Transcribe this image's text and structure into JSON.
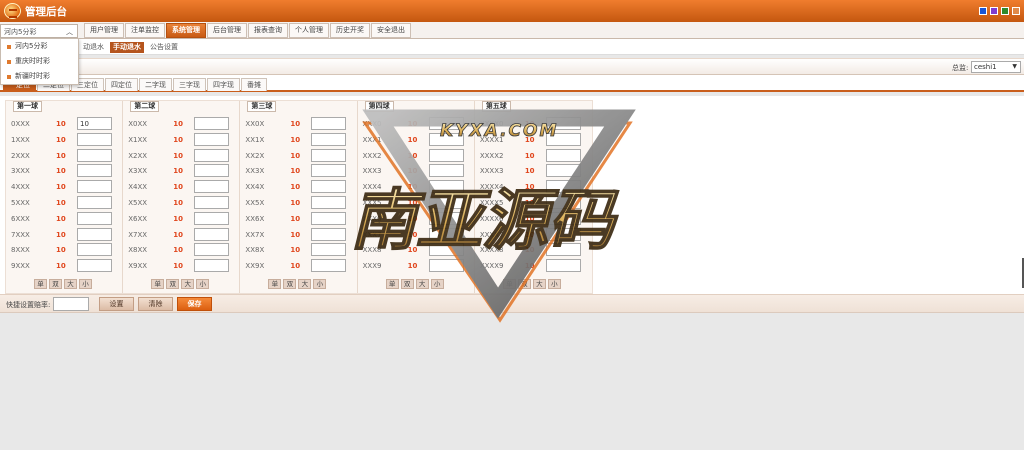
{
  "app": {
    "title": "管理后台",
    "theme_swatches": [
      "#1a56d6",
      "#7d3ccf",
      "#2f8a2c",
      "#e08a4a"
    ]
  },
  "lottery_select": {
    "value": "河内5分彩"
  },
  "lottery_dropdown": {
    "items": [
      "河内5分彩",
      "重庆时时彩",
      "新疆时时彩"
    ]
  },
  "nav": {
    "items": [
      {
        "label": "用户管理",
        "active": false
      },
      {
        "label": "注单监控",
        "active": false
      },
      {
        "label": "系统管理",
        "active": true
      },
      {
        "label": "后台管理",
        "active": false
      },
      {
        "label": "报表查询",
        "active": false
      },
      {
        "label": "个人管理",
        "active": false
      },
      {
        "label": "历史开奖",
        "active": false
      },
      {
        "label": "安全退出",
        "active": false
      }
    ]
  },
  "subnav": {
    "items": [
      {
        "label": "动退水",
        "active": false
      },
      {
        "label": "手动退水",
        "active": true
      },
      {
        "label": "公告设置",
        "active": false
      }
    ]
  },
  "account": {
    "label": "总监:",
    "value": "ceshi1"
  },
  "tabs": [
    {
      "label": "一定位",
      "active": true
    },
    {
      "label": "二定位",
      "active": false
    },
    {
      "label": "三定位",
      "active": false
    },
    {
      "label": "四定位",
      "active": false
    },
    {
      "label": "二字现",
      "active": false
    },
    {
      "label": "三字现",
      "active": false
    },
    {
      "label": "四字现",
      "active": false
    },
    {
      "label": "番摊",
      "active": false
    }
  ],
  "panels": [
    {
      "title": "第一球",
      "rows": [
        {
          "label": "0XXX",
          "odds": "10",
          "value": "10"
        },
        {
          "label": "1XXX",
          "odds": "10",
          "value": ""
        },
        {
          "label": "2XXX",
          "odds": "10",
          "value": ""
        },
        {
          "label": "3XXX",
          "odds": "10",
          "value": ""
        },
        {
          "label": "4XXX",
          "odds": "10",
          "value": ""
        },
        {
          "label": "5XXX",
          "odds": "10",
          "value": ""
        },
        {
          "label": "6XXX",
          "odds": "10",
          "value": ""
        },
        {
          "label": "7XXX",
          "odds": "10",
          "value": ""
        },
        {
          "label": "8XXX",
          "odds": "10",
          "value": ""
        },
        {
          "label": "9XXX",
          "odds": "10",
          "value": ""
        }
      ]
    },
    {
      "title": "第二球",
      "rows": [
        {
          "label": "X0XX",
          "odds": "10",
          "value": ""
        },
        {
          "label": "X1XX",
          "odds": "10",
          "value": ""
        },
        {
          "label": "X2XX",
          "odds": "10",
          "value": ""
        },
        {
          "label": "X3XX",
          "odds": "10",
          "value": ""
        },
        {
          "label": "X4XX",
          "odds": "10",
          "value": ""
        },
        {
          "label": "X5XX",
          "odds": "10",
          "value": ""
        },
        {
          "label": "X6XX",
          "odds": "10",
          "value": ""
        },
        {
          "label": "X7XX",
          "odds": "10",
          "value": ""
        },
        {
          "label": "X8XX",
          "odds": "10",
          "value": ""
        },
        {
          "label": "X9XX",
          "odds": "10",
          "value": ""
        }
      ]
    },
    {
      "title": "第三球",
      "rows": [
        {
          "label": "XX0X",
          "odds": "10",
          "value": ""
        },
        {
          "label": "XX1X",
          "odds": "10",
          "value": ""
        },
        {
          "label": "XX2X",
          "odds": "10",
          "value": ""
        },
        {
          "label": "XX3X",
          "odds": "10",
          "value": ""
        },
        {
          "label": "XX4X",
          "odds": "10",
          "value": ""
        },
        {
          "label": "XX5X",
          "odds": "10",
          "value": ""
        },
        {
          "label": "XX6X",
          "odds": "10",
          "value": ""
        },
        {
          "label": "XX7X",
          "odds": "10",
          "value": ""
        },
        {
          "label": "XX8X",
          "odds": "10",
          "value": ""
        },
        {
          "label": "XX9X",
          "odds": "10",
          "value": ""
        }
      ]
    },
    {
      "title": "第四球",
      "rows": [
        {
          "label": "XXX0",
          "odds": "10",
          "value": ""
        },
        {
          "label": "XXX1",
          "odds": "10",
          "value": ""
        },
        {
          "label": "XXX2",
          "odds": "10",
          "value": ""
        },
        {
          "label": "XXX3",
          "odds": "10",
          "value": ""
        },
        {
          "label": "XXX4",
          "odds": "10",
          "value": ""
        },
        {
          "label": "XXX5",
          "odds": "10",
          "value": ""
        },
        {
          "label": "XXX6",
          "odds": "10",
          "value": ""
        },
        {
          "label": "XXX7",
          "odds": "10",
          "value": ""
        },
        {
          "label": "XXX8",
          "odds": "10",
          "value": ""
        },
        {
          "label": "XXX9",
          "odds": "10",
          "value": ""
        }
      ]
    },
    {
      "title": "第五球",
      "rows": [
        {
          "label": "XXXX0",
          "odds": "10",
          "value": ""
        },
        {
          "label": "XXXX1",
          "odds": "10",
          "value": ""
        },
        {
          "label": "XXXX2",
          "odds": "10",
          "value": ""
        },
        {
          "label": "XXXX3",
          "odds": "10",
          "value": ""
        },
        {
          "label": "XXXX4",
          "odds": "10",
          "value": ""
        },
        {
          "label": "XXXX5",
          "odds": "10",
          "value": ""
        },
        {
          "label": "XXXX6",
          "odds": "10",
          "value": ""
        },
        {
          "label": "XXXX7",
          "odds": "10",
          "value": ""
        },
        {
          "label": "XXXX8",
          "odds": "10",
          "value": ""
        },
        {
          "label": "XXXX9",
          "odds": "10",
          "value": ""
        }
      ]
    }
  ],
  "quick_buttons": [
    "单",
    "双",
    "大",
    "小"
  ],
  "footer": {
    "quick_label": "快捷设置赔率:",
    "quick_value": "",
    "set_label": "设置",
    "clear_label": "清除",
    "save_label": "保存"
  },
  "watermark": {
    "top_text": "KYXA.COM",
    "main_text": "南亚源码",
    "colors": {
      "gold": "#d9b45a",
      "dark": "#3a3a3a",
      "orange": "#e07020"
    }
  }
}
